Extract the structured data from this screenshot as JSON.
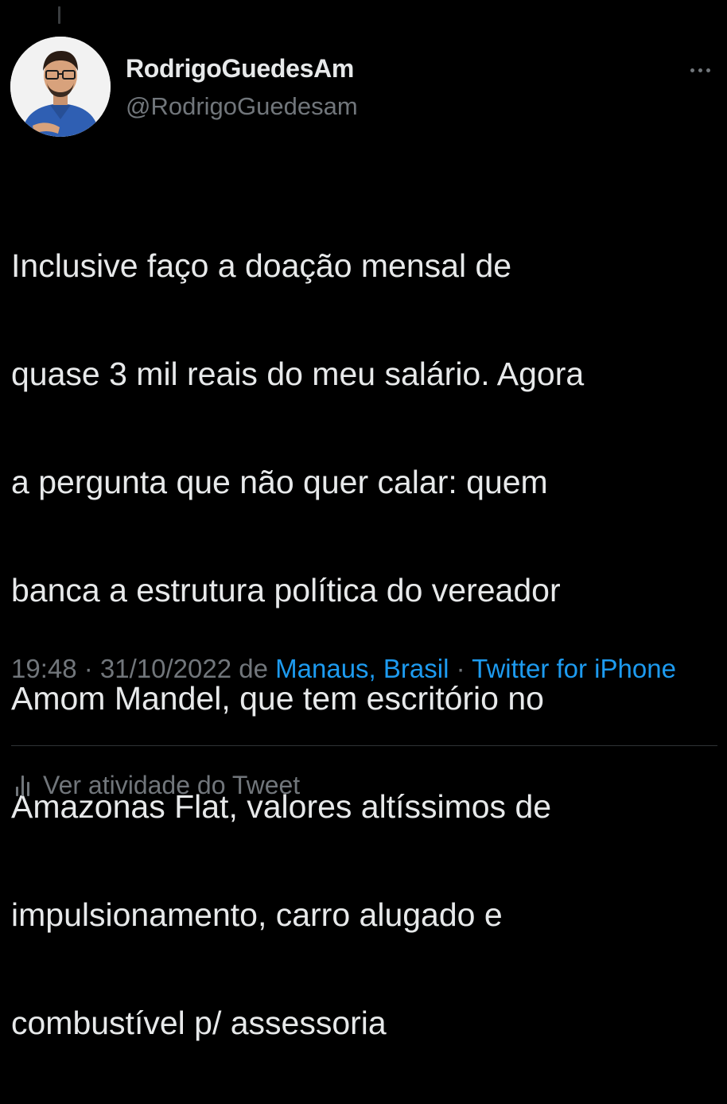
{
  "user": {
    "display_name": "RodrigoGuedesAm",
    "handle": "@RodrigoGuedesam"
  },
  "tweet": {
    "text_lines": [
      "Inclusive faço a doação mensal de",
      "quase 3 mil reais do meu salário. Agora",
      "a pergunta que não quer calar: quem",
      "banca a estrutura política do vereador",
      "Amom Mandel, que tem escritório no",
      "Amazonas Flat, valores altíssimos de",
      "impulsionamento, carro alugado e",
      "combustível p/ assessoria"
    ]
  },
  "meta": {
    "time": "19:48",
    "separator": " · ",
    "date": "31/10/2022",
    "from_word": " de ",
    "location": "Manaus, Brasil",
    "source": "Twitter for iPhone"
  },
  "activity": {
    "label": "Ver atividade do Tweet"
  },
  "icons": {
    "more": "more-horizontal-icon",
    "activity": "bar-chart-icon"
  },
  "colors": {
    "background": "#000000",
    "primary_text": "#e7e9ea",
    "secondary_text": "#71767b",
    "link": "#1d9bf0",
    "divider": "#2f3336"
  }
}
